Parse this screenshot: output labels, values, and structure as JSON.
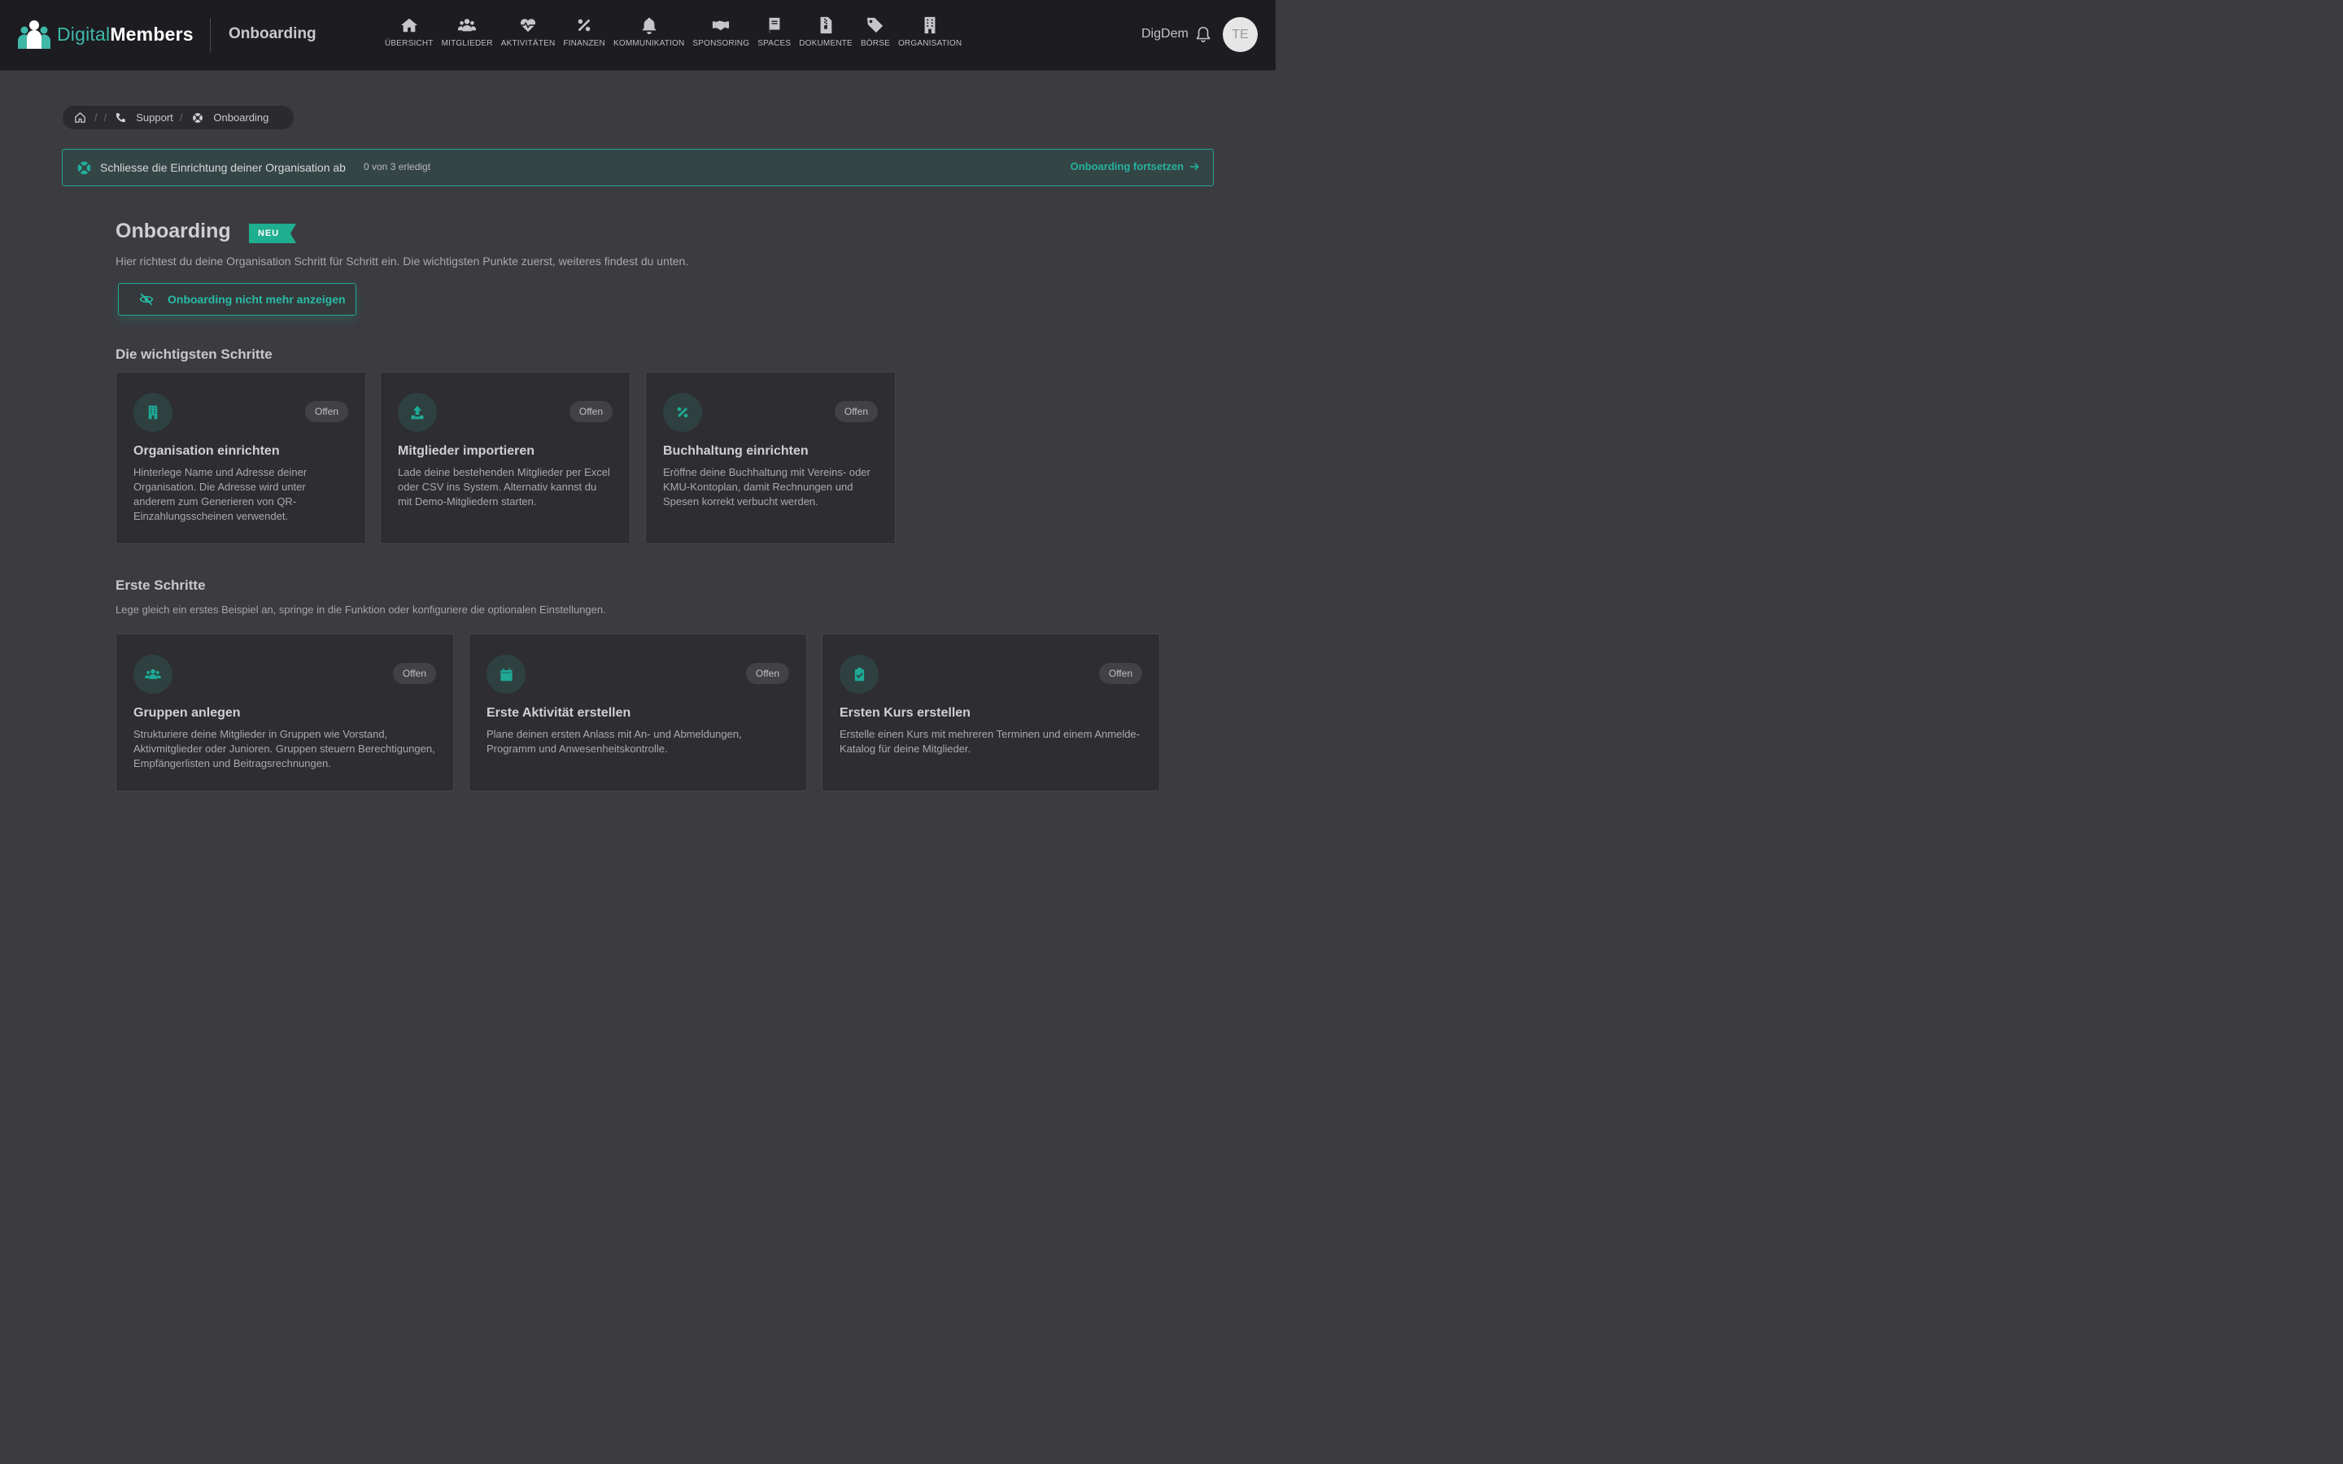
{
  "header": {
    "logo_part1": "Digital",
    "logo_part2": "Members",
    "app_title": "Onboarding",
    "user_name": "DigDem",
    "avatar_initials": "TE",
    "nav": [
      {
        "label": "ÜBERSICHT",
        "icon": "home-icon"
      },
      {
        "label": "MITGLIEDER",
        "icon": "users-icon"
      },
      {
        "label": "AKTIVITÄTEN",
        "icon": "heartbeat-icon"
      },
      {
        "label": "FINANZEN",
        "icon": "percent-icon"
      },
      {
        "label": "KOMMUNIKATION",
        "icon": "bell-icon"
      },
      {
        "label": "SPONSORING",
        "icon": "handshake-icon"
      },
      {
        "label": "SPACES",
        "icon": "book-icon"
      },
      {
        "label": "DOKUMENTE",
        "icon": "file-zip-icon"
      },
      {
        "label": "BÖRSE",
        "icon": "tags-icon"
      },
      {
        "label": "ORGANISATION",
        "icon": "building-icon"
      }
    ]
  },
  "breadcrumb": {
    "items": [
      "Support",
      "Onboarding"
    ]
  },
  "banner": {
    "title": "Schliesse die Einrichtung deiner Organisation ab",
    "progress": "0 von 3 erledigt",
    "link": "Onboarding fortsetzen"
  },
  "main": {
    "title": "Onboarding",
    "badge": "NEU",
    "lead": "Hier richtest du deine Organisation Schritt für Schritt ein. Die wichtigsten Punkte zuerst, weiteres findest du unten.",
    "hide_button": "Onboarding nicht mehr anzeigen"
  },
  "important": {
    "title": "Die wichtigsten Schritte",
    "cards": [
      {
        "title": "Organisation einrichten",
        "status": "Offen",
        "icon": "building-icon",
        "desc": "Hinterlege Name und Adresse deiner Organisation. Die Adresse wird unter anderem zum Generieren von QR-Einzahlungsscheinen verwendet."
      },
      {
        "title": "Mitglieder importieren",
        "status": "Offen",
        "icon": "upload-icon",
        "desc": "Lade deine bestehenden Mitglieder per Excel oder CSV ins System. Alternativ kannst du mit Demo-Mitgliedern starten."
      },
      {
        "title": "Buchhaltung einrichten",
        "status": "Offen",
        "icon": "percent-icon",
        "desc": "Eröffne deine Buchhaltung mit Vereins- oder KMU-Kontoplan, damit Rechnungen und Spesen korrekt verbucht werden."
      }
    ]
  },
  "first_steps": {
    "title": "Erste Schritte",
    "subtitle": "Lege gleich ein erstes Beispiel an, springe in die Funktion oder konfiguriere die optionalen Einstellungen.",
    "cards": [
      {
        "title": "Gruppen anlegen",
        "status": "Offen",
        "icon": "users-icon",
        "desc": "Strukturiere deine Mitglieder in Gruppen wie Vorstand, Aktivmitglieder oder Junioren. Gruppen steuern Berechtigungen, Empfängerlisten und Beitragsrechnungen."
      },
      {
        "title": "Erste Aktivität erstellen",
        "status": "Offen",
        "icon": "calendar-icon",
        "desc": "Plane deinen ersten Anlass mit An- und Abmeldungen, Programm und Anwesenheitskontrolle."
      },
      {
        "title": "Ersten Kurs erstellen",
        "status": "Offen",
        "icon": "clipboard-check-icon",
        "desc": "Erstelle einen Kurs mit mehreren Terminen und einem Anmelde-Katalog für deine Mitglieder."
      }
    ]
  },
  "colors": {
    "accent": "#24b39f",
    "header_bg": "#1c1c21",
    "page_bg": "#3b3b40",
    "card_bg": "#2d2d32"
  }
}
